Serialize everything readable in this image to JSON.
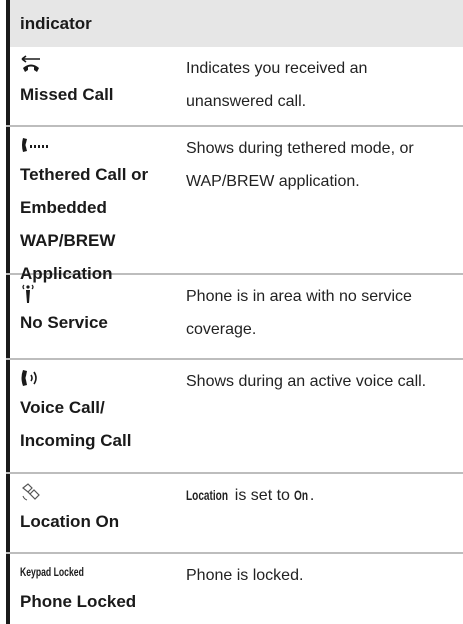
{
  "header": {
    "title": "indicator"
  },
  "rows": [
    {
      "icon": "missed-call-icon",
      "name": "Missed Call",
      "desc": "Indicates you received an unanswered call."
    },
    {
      "icon": "tethered-call-icon",
      "name_lines": [
        "Tethered Call or",
        "Embedded",
        "WAP/BREW",
        "Application"
      ],
      "desc": "Shows during tethered mode, or WAP/BREW application."
    },
    {
      "icon": "no-service-icon",
      "name": "No Service",
      "desc": "Phone is in area with no service coverage."
    },
    {
      "icon": "voice-call-icon",
      "name_lines": [
        "Voice Call/",
        "Incoming Call"
      ],
      "desc": "Shows during an active voice call."
    },
    {
      "icon": "location-on-icon",
      "name": "Location On",
      "desc_parts": {
        "kw1": "Location",
        "mid": " is set to ",
        "kw2": "On",
        "end": "."
      }
    },
    {
      "label": "Keypad Locked",
      "name": "Phone Locked",
      "desc": "Phone is locked."
    }
  ]
}
